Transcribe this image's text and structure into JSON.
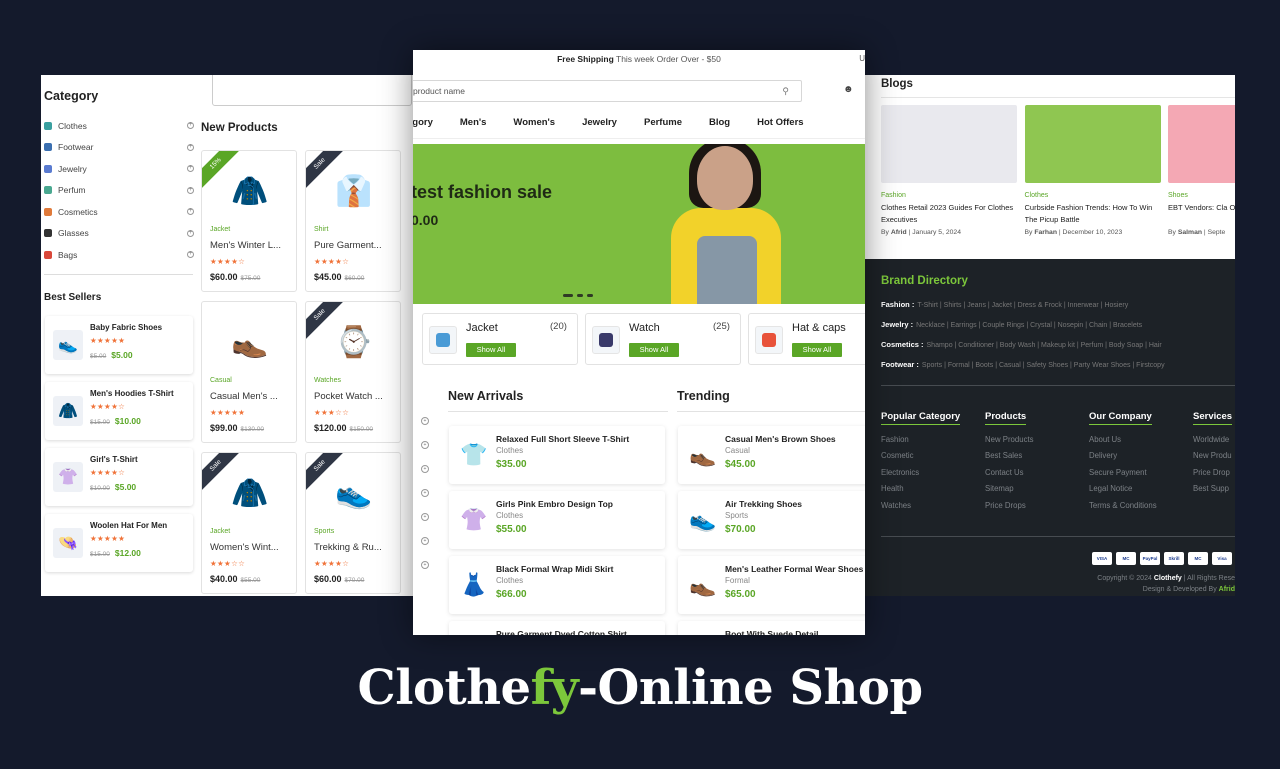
{
  "left": {
    "category_title": "Category",
    "categories": [
      {
        "label": "Clothes",
        "color": "#3aa0a0"
      },
      {
        "label": "Footwear",
        "color": "#3b6fb0"
      },
      {
        "label": "Jewelry",
        "color": "#5a7bd0"
      },
      {
        "label": "Perfum",
        "color": "#4aa890"
      },
      {
        "label": "Cosmetics",
        "color": "#e07a3a"
      },
      {
        "label": "Glasses",
        "color": "#333333"
      },
      {
        "label": "Bags",
        "color": "#d9483a"
      }
    ],
    "best_sellers_title": "Best Sellers",
    "best_sellers": [
      {
        "name": "Baby Fabric Shoes",
        "stars": "★★★★★",
        "old": "$5.00",
        "price": "$5.00",
        "icon": "👟"
      },
      {
        "name": "Men's Hoodies T-Shirt",
        "stars": "★★★★☆",
        "old": "$15.00",
        "price": "$10.00",
        "icon": "🧥"
      },
      {
        "name": "Girl's T-Shirt",
        "stars": "★★★★☆",
        "old": "$10.00",
        "price": "$5.00",
        "icon": "👚"
      },
      {
        "name": "Woolen Hat For Men",
        "stars": "★★★★★",
        "old": "$15.00",
        "price": "$12.00",
        "icon": "👒"
      }
    ],
    "new_products_title": "New Products",
    "products": [
      {
        "badge": "15%",
        "badge_color": "#5aa626",
        "icon": "🧥",
        "cat": "Jacket",
        "name": "Men's Winter L...",
        "stars": "★★★★☆",
        "price": "$60.00",
        "old": "$75.00"
      },
      {
        "badge": "Sale",
        "badge_color": "#2f3645",
        "icon": "👔",
        "cat": "Shirt",
        "name": "Pure Garment...",
        "stars": "★★★★☆",
        "price": "$45.00",
        "old": "$60.00"
      },
      {
        "badge": "",
        "badge_color": "",
        "icon": "👞",
        "cat": "Casual",
        "name": "Casual Men's ...",
        "stars": "★★★★★",
        "price": "$99.00",
        "old": "$130.00"
      },
      {
        "badge": "Sale",
        "badge_color": "#2f3645",
        "icon": "⌚",
        "cat": "Watches",
        "name": "Pocket Watch ...",
        "stars": "★★★☆☆",
        "price": "$120.00",
        "old": "$150.00"
      },
      {
        "badge": "Sale",
        "badge_color": "#2f3645",
        "icon": "🧥",
        "cat": "Jacket",
        "name": "Women's Wint...",
        "stars": "★★★☆☆",
        "price": "$40.00",
        "old": "$55.00"
      },
      {
        "badge": "Sale",
        "badge_color": "#2f3645",
        "icon": "👟",
        "cat": "Sports",
        "name": "Trekking & Ru...",
        "stars": "★★★★☆",
        "price": "$60.00",
        "old": "$70.00"
      }
    ]
  },
  "center": {
    "shipping_bold": "Free Shipping",
    "shipping_text": "This week Order Over - $50",
    "currency": "U",
    "search_placeholder": "product name",
    "nav": [
      "egory",
      "Men's",
      "Women's",
      "Jewelry",
      "Perfume",
      "Blog",
      "Hot Offers"
    ],
    "hero_line1": "test fashion sale",
    "hero_line2": "0.00",
    "categories": [
      {
        "name": "Jacket",
        "count": "(20)",
        "btn": "Show All",
        "color": "#4a9bd6"
      },
      {
        "name": "Watch",
        "count": "(25)",
        "btn": "Show All",
        "color": "#3a3a6a"
      },
      {
        "name": "Hat & caps",
        "count": "",
        "btn": "Show All",
        "color": "#e8523a"
      }
    ],
    "new_arrivals_title": "New Arrivals",
    "trending_title": "Trending",
    "new_arrivals": [
      {
        "name": "Relaxed Full Short Sleeve T-Shirt",
        "cat": "Clothes",
        "price": "$35.00",
        "icon": "👕"
      },
      {
        "name": "Girls Pink Embro Design Top",
        "cat": "Clothes",
        "price": "$55.00",
        "icon": "👚"
      },
      {
        "name": "Black Formal Wrap Midi Skirt",
        "cat": "Clothes",
        "price": "$66.00",
        "icon": "👗"
      },
      {
        "name": "Pure Garment Dyed Cotton Shirt",
        "cat": "",
        "price": "",
        "icon": ""
      }
    ],
    "trending": [
      {
        "name": "Casual Men's Brown Shoes",
        "cat": "Casual",
        "price": "$45.00",
        "icon": "👞"
      },
      {
        "name": "Air Trekking Shoes",
        "cat": "Sports",
        "price": "$70.00",
        "icon": "👟"
      },
      {
        "name": "Men's Leather Formal Wear Shoes",
        "cat": "Formal",
        "price": "$65.00",
        "icon": "👞"
      },
      {
        "name": "Boot With Suede Detail",
        "cat": "",
        "price": "",
        "icon": ""
      }
    ]
  },
  "right": {
    "blogs_title": "Blogs",
    "blogs": [
      {
        "cat": "Fashion",
        "title": "Clothes Retail 2023 Guides For Clothes Executives",
        "by": "Afrid",
        "date": "January 5, 2024",
        "bg": "#e9e9ee"
      },
      {
        "cat": "Clothes",
        "title": "Curbside Fashion Trends: How To Win The Picup Battle",
        "by": "Farhan",
        "date": "December 10, 2023",
        "bg": "#8fc651"
      },
      {
        "cat": "Shoes",
        "title": "EBT Vendors: Cla Of SNAP Online R",
        "by": "Salman",
        "date": "Septe",
        "bg": "#f4a8b4"
      }
    ],
    "brand_title": "Brand Directory",
    "brand_rows": [
      {
        "label": "Fashion :",
        "items": "T-Shirt | Shirts | Jeans | Jacket | Dress & Frock | Innerwear | Hosiery"
      },
      {
        "label": "Jewelry :",
        "items": "Necklace | Earrings | Couple Rings | Crystal | Nosepin | Chain | Bracelets"
      },
      {
        "label": "Cosmetics :",
        "items": "Shampo | Conditioner | Body Wash | Makeup kit | Perfum | Body Soap | Hair"
      },
      {
        "label": "Footwear :",
        "items": "Sports | Formal | Boots | Casual | Safety Shoes | Party Wear Shoes | Firstcopy"
      }
    ],
    "footer_cols": [
      {
        "title": "Popular Category",
        "items": [
          "Fashion",
          "Cosmetic",
          "Electronics",
          "Health",
          "Watches"
        ]
      },
      {
        "title": "Products",
        "items": [
          "New Products",
          "Best Sales",
          "Contact Us",
          "Sitemap",
          "Price Drops"
        ]
      },
      {
        "title": "Our Company",
        "items": [
          "About Us",
          "Delivery",
          "Secure Payment",
          "Legal Notice",
          "Terms & Conditions"
        ]
      },
      {
        "title": "Services",
        "items": [
          "Worldwide",
          "New Produ",
          "Price Drop",
          "Best Supp"
        ]
      }
    ],
    "payments": [
      "VISA",
      "MC",
      "PayPal",
      "Skrill",
      "MC",
      "Visa"
    ],
    "copyright_pre": "Copyright © 2024",
    "copyright_brand": "Clothefy",
    "copyright_post": "| All Rights Rese",
    "designed_pre": "Design & Developed By",
    "designed_by": "Afrid"
  },
  "brand": {
    "part1": "Clothe",
    "part2": "fy",
    "part3": "-Online Shop",
    "accent": "#7cc73b"
  }
}
